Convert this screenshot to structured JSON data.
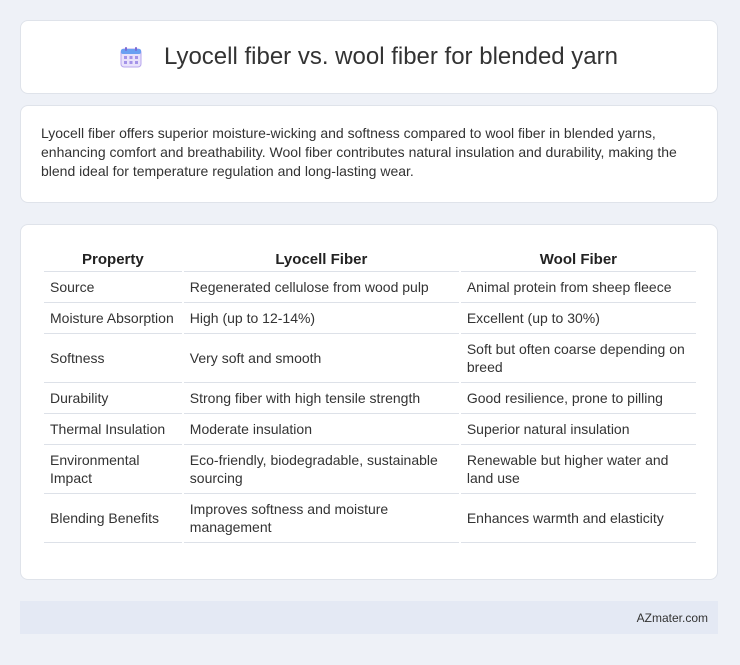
{
  "header": {
    "title": "Lyocell fiber vs. wool fiber for blended yarn",
    "icon": "calendar-icon"
  },
  "intro": {
    "text": "Lyocell fiber offers superior moisture-wicking and softness compared to wool fiber in blended yarns, enhancing comfort and breathability. Wool fiber contributes natural insulation and durability, making the blend ideal for temperature regulation and long-lasting wear."
  },
  "table": {
    "headers": [
      "Property",
      "Lyocell Fiber",
      "Wool Fiber"
    ],
    "rows": [
      [
        "Source",
        "Regenerated cellulose from wood pulp",
        "Animal protein from sheep fleece"
      ],
      [
        "Moisture Absorption",
        "High (up to 12-14%)",
        "Excellent (up to 30%)"
      ],
      [
        "Softness",
        "Very soft and smooth",
        "Soft but often coarse depending on breed"
      ],
      [
        "Durability",
        "Strong fiber with high tensile strength",
        "Good resilience, prone to pilling"
      ],
      [
        "Thermal Insulation",
        "Moderate insulation",
        "Superior natural insulation"
      ],
      [
        "Environmental Impact",
        "Eco-friendly, biodegradable, sustainable sourcing",
        "Renewable but higher water and land use"
      ],
      [
        "Blending Benefits",
        "Improves softness and moisture management",
        "Enhances warmth and elasticity"
      ]
    ]
  },
  "footer": {
    "text": "AZmater.com"
  }
}
